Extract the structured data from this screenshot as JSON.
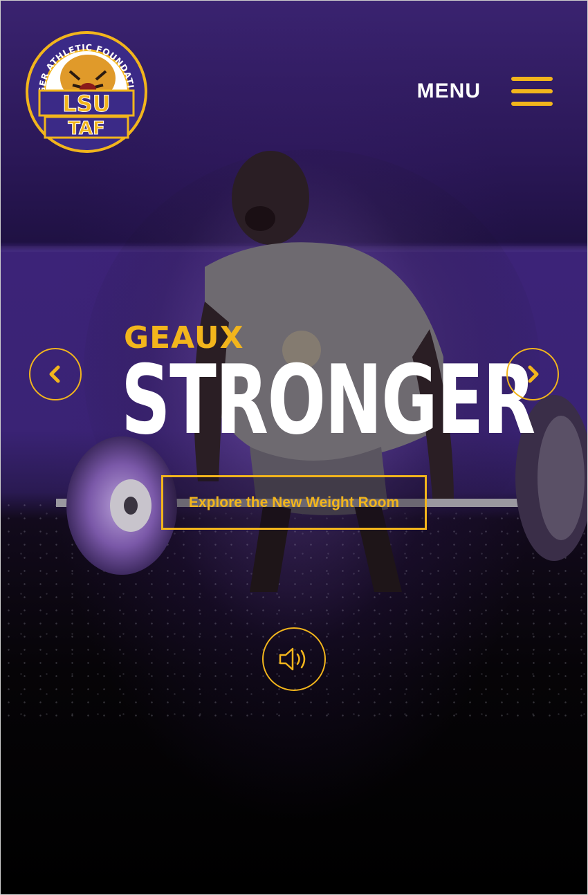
{
  "header": {
    "menu_label": "MENU"
  },
  "logo": {
    "ring_text": "TIGER ATHLETIC FOUNDATION",
    "line1": "LSU",
    "line2": "TAF"
  },
  "hero": {
    "kicker": "GEAUX",
    "headline": "STRONGER",
    "cta_label": "Explore the New Weight Room"
  },
  "icons": {
    "menu": "hamburger-icon",
    "prev": "chevron-left-icon",
    "next": "chevron-right-icon",
    "sound": "speaker-icon"
  },
  "colors": {
    "accent_gold": "#f2b51c",
    "brand_purple": "#3a2375",
    "logo_purple": "#3b2a87"
  }
}
